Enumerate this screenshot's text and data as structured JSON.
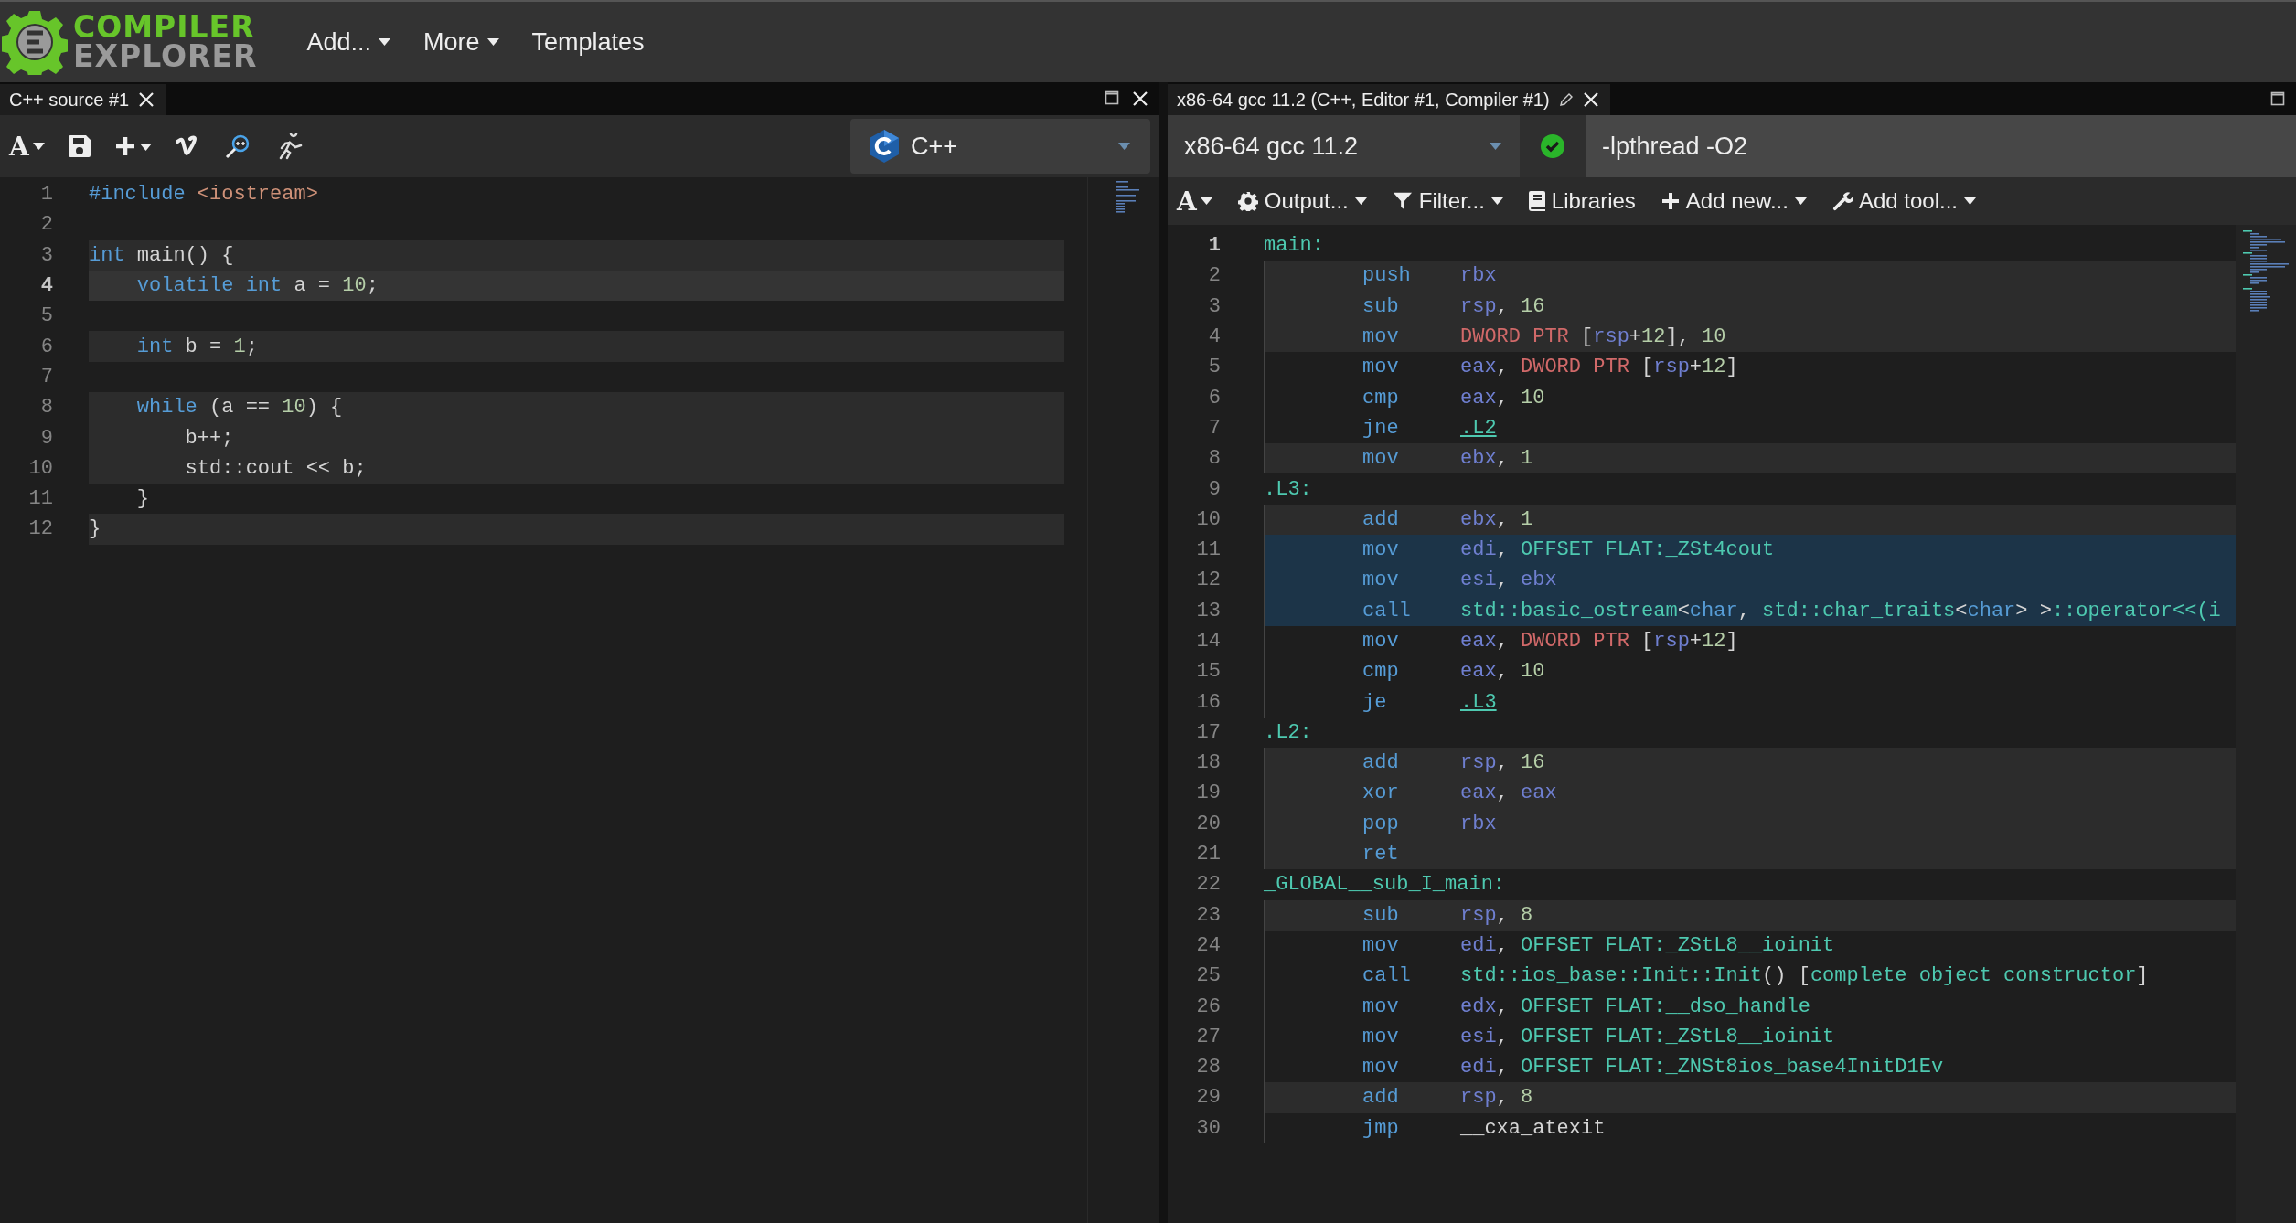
{
  "header": {
    "logo": {
      "line1": "COMPILER",
      "line2": "EXPLORER"
    },
    "menu": [
      {
        "label": "Add...",
        "dropdown": true
      },
      {
        "label": "More",
        "dropdown": true
      },
      {
        "label": "Templates",
        "dropdown": false
      }
    ]
  },
  "editor": {
    "tab": {
      "title": "C++ source #1"
    },
    "font_button": "A",
    "language": "C++",
    "lines": [
      {
        "number": "1",
        "current": false,
        "highlighted": false,
        "tokens": [
          {
            "kind": "keyword",
            "text": "#include"
          },
          {
            "kind": "string",
            "text": " <iostream>"
          }
        ]
      },
      {
        "number": "2",
        "current": false,
        "highlighted": false
      },
      {
        "number": "3",
        "current": false,
        "highlighted": true,
        "tokens": [
          {
            "kind": "keyword",
            "text": "int"
          },
          {
            "kind": "plain",
            "text": " main() {"
          }
        ]
      },
      {
        "number": "4",
        "current": true,
        "highlighted": true,
        "tokens": [
          {
            "kind": "keyword",
            "text": "    volatile"
          },
          {
            "kind": "keyword",
            "text": " int"
          },
          {
            "kind": "plain",
            "text": " a = "
          },
          {
            "kind": "number",
            "text": "10"
          },
          {
            "kind": "plain",
            "text": ";"
          }
        ]
      },
      {
        "number": "5",
        "current": false,
        "highlighted": false
      },
      {
        "number": "6",
        "current": false,
        "highlighted": true,
        "tokens": [
          {
            "kind": "keyword",
            "text": "    int"
          },
          {
            "kind": "plain",
            "text": " b = "
          },
          {
            "kind": "number",
            "text": "1"
          },
          {
            "kind": "plain",
            "text": ";"
          }
        ]
      },
      {
        "number": "7",
        "current": false,
        "highlighted": false
      },
      {
        "number": "8",
        "current": false,
        "highlighted": true,
        "tokens": [
          {
            "kind": "keyword",
            "text": "    while"
          },
          {
            "kind": "plain",
            "text": " (a == "
          },
          {
            "kind": "number",
            "text": "10"
          },
          {
            "kind": "plain",
            "text": ") {"
          }
        ]
      },
      {
        "number": "9",
        "current": false,
        "highlighted": true,
        "tokens": [
          {
            "kind": "plain",
            "text": "        b++;"
          }
        ]
      },
      {
        "number": "10",
        "current": false,
        "highlighted": true,
        "tokens": [
          {
            "kind": "plain",
            "text": "        std::cout << b;"
          }
        ]
      },
      {
        "number": "11",
        "current": false,
        "highlighted": false,
        "tokens": [
          {
            "kind": "plain",
            "text": "    }"
          }
        ]
      },
      {
        "number": "12",
        "current": false,
        "highlighted": true,
        "tokens": [
          {
            "kind": "plain",
            "text": "}"
          }
        ]
      }
    ]
  },
  "compiler": {
    "tab": {
      "title": "x86-64 gcc 11.2 (C++, Editor #1, Compiler #1)"
    },
    "name": "x86-64 gcc 11.2",
    "success": true,
    "options": "-lpthread -O2",
    "font_button": "A",
    "toolbar": [
      {
        "label": "Output...",
        "dropdown": true
      },
      {
        "label": "Filter...",
        "dropdown": true
      },
      {
        "label": "Libraries",
        "dropdown": false
      },
      {
        "label": "Add new...",
        "dropdown": true
      },
      {
        "label": "Add tool...",
        "dropdown": true
      }
    ],
    "lines": [
      {
        "number": "1",
        "current": true,
        "highlighted": false,
        "selected": false,
        "kind": "label",
        "tokens": [
          {
            "kind": "label",
            "text": "main:"
          }
        ]
      },
      {
        "number": "2",
        "current": false,
        "highlighted": true,
        "selected": false,
        "kind": "instruction",
        "mnemonic": "push",
        "tokens": [
          {
            "kind": "register",
            "text": "rbx"
          }
        ]
      },
      {
        "number": "3",
        "current": false,
        "highlighted": true,
        "selected": false,
        "kind": "instruction",
        "mnemonic": "sub",
        "tokens": [
          {
            "kind": "register",
            "text": "rsp"
          },
          {
            "kind": "plain",
            "text": ", "
          },
          {
            "kind": "number",
            "text": "16"
          }
        ]
      },
      {
        "number": "4",
        "current": false,
        "highlighted": true,
        "selected": false,
        "kind": "instruction",
        "mnemonic": "mov",
        "tokens": [
          {
            "kind": "size",
            "text": "DWORD PTR"
          },
          {
            "kind": "plain",
            "text": " ["
          },
          {
            "kind": "register",
            "text": "rsp"
          },
          {
            "kind": "plain",
            "text": "+"
          },
          {
            "kind": "number",
            "text": "12"
          },
          {
            "kind": "plain",
            "text": "], "
          },
          {
            "kind": "number",
            "text": "10"
          }
        ]
      },
      {
        "number": "5",
        "current": false,
        "highlighted": false,
        "selected": false,
        "kind": "instruction",
        "mnemonic": "mov",
        "tokens": [
          {
            "kind": "register",
            "text": "eax"
          },
          {
            "kind": "plain",
            "text": ", "
          },
          {
            "kind": "size",
            "text": "DWORD PTR"
          },
          {
            "kind": "plain",
            "text": " ["
          },
          {
            "kind": "register",
            "text": "rsp"
          },
          {
            "kind": "plain",
            "text": "+"
          },
          {
            "kind": "number",
            "text": "12"
          },
          {
            "kind": "plain",
            "text": "]"
          }
        ]
      },
      {
        "number": "6",
        "current": false,
        "highlighted": false,
        "selected": false,
        "kind": "instruction",
        "mnemonic": "cmp",
        "tokens": [
          {
            "kind": "register",
            "text": "eax"
          },
          {
            "kind": "plain",
            "text": ", "
          },
          {
            "kind": "number",
            "text": "10"
          }
        ]
      },
      {
        "number": "7",
        "current": false,
        "highlighted": false,
        "selected": false,
        "kind": "instruction",
        "mnemonic": "jne",
        "tokens": [
          {
            "kind": "link",
            "text": ".L2"
          }
        ]
      },
      {
        "number": "8",
        "current": false,
        "highlighted": true,
        "selected": false,
        "kind": "instruction",
        "mnemonic": "mov",
        "tokens": [
          {
            "kind": "register",
            "text": "ebx"
          },
          {
            "kind": "plain",
            "text": ", "
          },
          {
            "kind": "number",
            "text": "1"
          }
        ]
      },
      {
        "number": "9",
        "current": false,
        "highlighted": false,
        "selected": false,
        "kind": "label",
        "tokens": [
          {
            "kind": "label",
            "text": ".L3:"
          }
        ]
      },
      {
        "number": "10",
        "current": false,
        "highlighted": true,
        "selected": false,
        "kind": "instruction",
        "mnemonic": "add",
        "tokens": [
          {
            "kind": "register",
            "text": "ebx"
          },
          {
            "kind": "plain",
            "text": ", "
          },
          {
            "kind": "number",
            "text": "1"
          }
        ]
      },
      {
        "number": "11",
        "current": false,
        "selected": true,
        "kind": "instruction",
        "mnemonic": "mov",
        "tokens": [
          {
            "kind": "register",
            "text": "edi"
          },
          {
            "kind": "plain",
            "text": ", "
          },
          {
            "kind": "symbol",
            "text": "OFFSET FLAT:_ZSt4cout"
          }
        ]
      },
      {
        "number": "12",
        "current": false,
        "selected": true,
        "kind": "instruction",
        "mnemonic": "mov",
        "tokens": [
          {
            "kind": "register",
            "text": "esi"
          },
          {
            "kind": "plain",
            "text": ", "
          },
          {
            "kind": "register",
            "text": "ebx"
          }
        ]
      },
      {
        "number": "13",
        "current": false,
        "selected": true,
        "kind": "instruction",
        "mnemonic": "call",
        "tokens": [
          {
            "kind": "symbol",
            "text": "std::basic_ostream"
          },
          {
            "kind": "plain",
            "text": "<"
          },
          {
            "kind": "keyword",
            "text": "char"
          },
          {
            "kind": "plain",
            "text": ", "
          },
          {
            "kind": "symbol",
            "text": "std::char_traits"
          },
          {
            "kind": "plain",
            "text": "<"
          },
          {
            "kind": "keyword",
            "text": "char"
          },
          {
            "kind": "plain",
            "text": "> >"
          },
          {
            "kind": "symbol",
            "text": "::operator<<(i"
          }
        ]
      },
      {
        "number": "14",
        "current": false,
        "highlighted": false,
        "selected": false,
        "kind": "instruction",
        "mnemonic": "mov",
        "tokens": [
          {
            "kind": "register",
            "text": "eax"
          },
          {
            "kind": "plain",
            "text": ", "
          },
          {
            "kind": "size",
            "text": "DWORD PTR"
          },
          {
            "kind": "plain",
            "text": " ["
          },
          {
            "kind": "register",
            "text": "rsp"
          },
          {
            "kind": "plain",
            "text": "+"
          },
          {
            "kind": "number",
            "text": "12"
          },
          {
            "kind": "plain",
            "text": "]"
          }
        ]
      },
      {
        "number": "15",
        "current": false,
        "highlighted": false,
        "selected": false,
        "kind": "instruction",
        "mnemonic": "cmp",
        "tokens": [
          {
            "kind": "register",
            "text": "eax"
          },
          {
            "kind": "plain",
            "text": ", "
          },
          {
            "kind": "number",
            "text": "10"
          }
        ]
      },
      {
        "number": "16",
        "current": false,
        "highlighted": false,
        "selected": false,
        "kind": "instruction",
        "mnemonic": "je",
        "tokens": [
          {
            "kind": "link",
            "text": ".L3"
          }
        ]
      },
      {
        "number": "17",
        "current": false,
        "highlighted": false,
        "selected": false,
        "kind": "label",
        "tokens": [
          {
            "kind": "label",
            "text": ".L2:"
          }
        ]
      },
      {
        "number": "18",
        "current": false,
        "highlighted": true,
        "selected": false,
        "kind": "instruction",
        "mnemonic": "add",
        "tokens": [
          {
            "kind": "register",
            "text": "rsp"
          },
          {
            "kind": "plain",
            "text": ", "
          },
          {
            "kind": "number",
            "text": "16"
          }
        ]
      },
      {
        "number": "19",
        "current": false,
        "highlighted": true,
        "selected": false,
        "kind": "instruction",
        "mnemonic": "xor",
        "tokens": [
          {
            "kind": "register",
            "text": "eax"
          },
          {
            "kind": "plain",
            "text": ", "
          },
          {
            "kind": "register",
            "text": "eax"
          }
        ]
      },
      {
        "number": "20",
        "current": false,
        "highlighted": true,
        "selected": false,
        "kind": "instruction",
        "mnemonic": "pop",
        "tokens": [
          {
            "kind": "register",
            "text": "rbx"
          }
        ]
      },
      {
        "number": "21",
        "current": false,
        "highlighted": true,
        "selected": false,
        "kind": "instruction",
        "mnemonic": "ret"
      },
      {
        "number": "22",
        "current": false,
        "highlighted": false,
        "selected": false,
        "kind": "label",
        "tokens": [
          {
            "kind": "label",
            "text": "_GLOBAL__sub_I_main:"
          }
        ]
      },
      {
        "number": "23",
        "current": false,
        "highlighted": true,
        "selected": false,
        "kind": "instruction",
        "mnemonic": "sub",
        "tokens": [
          {
            "kind": "register",
            "text": "rsp"
          },
          {
            "kind": "plain",
            "text": ", "
          },
          {
            "kind": "number",
            "text": "8"
          }
        ]
      },
      {
        "number": "24",
        "current": false,
        "highlighted": false,
        "selected": false,
        "kind": "instruction",
        "mnemonic": "mov",
        "tokens": [
          {
            "kind": "register",
            "text": "edi"
          },
          {
            "kind": "plain",
            "text": ", "
          },
          {
            "kind": "symbol",
            "text": "OFFSET FLAT:_ZStL8__ioinit"
          }
        ]
      },
      {
        "number": "25",
        "current": false,
        "highlighted": false,
        "selected": false,
        "kind": "instruction",
        "mnemonic": "call",
        "tokens": [
          {
            "kind": "symbol",
            "text": "std::ios_base::Init::Init"
          },
          {
            "kind": "plain",
            "text": "() ["
          },
          {
            "kind": "symbol",
            "text": "complete object constructor"
          },
          {
            "kind": "plain",
            "text": "]"
          }
        ]
      },
      {
        "number": "26",
        "current": false,
        "highlighted": false,
        "selected": false,
        "kind": "instruction",
        "mnemonic": "mov",
        "tokens": [
          {
            "kind": "register",
            "text": "edx"
          },
          {
            "kind": "plain",
            "text": ", "
          },
          {
            "kind": "symbol",
            "text": "OFFSET FLAT:__dso_handle"
          }
        ]
      },
      {
        "number": "27",
        "current": false,
        "highlighted": false,
        "selected": false,
        "kind": "instruction",
        "mnemonic": "mov",
        "tokens": [
          {
            "kind": "register",
            "text": "esi"
          },
          {
            "kind": "plain",
            "text": ", "
          },
          {
            "kind": "symbol",
            "text": "OFFSET FLAT:_ZStL8__ioinit"
          }
        ]
      },
      {
        "number": "28",
        "current": false,
        "highlighted": false,
        "selected": false,
        "kind": "instruction",
        "mnemonic": "mov",
        "tokens": [
          {
            "kind": "register",
            "text": "edi"
          },
          {
            "kind": "plain",
            "text": ", "
          },
          {
            "kind": "symbol",
            "text": "OFFSET FLAT:_ZNSt8ios_base4InitD1Ev"
          }
        ]
      },
      {
        "number": "29",
        "current": false,
        "highlighted": true,
        "selected": false,
        "kind": "instruction",
        "mnemonic": "add",
        "tokens": [
          {
            "kind": "register",
            "text": "rsp"
          },
          {
            "kind": "plain",
            "text": ", "
          },
          {
            "kind": "number",
            "text": "8"
          }
        ]
      },
      {
        "number": "30",
        "current": false,
        "highlighted": false,
        "selected": false,
        "kind": "instruction",
        "mnemonic": "jmp",
        "tokens": [
          {
            "kind": "plain",
            "text": "__cxa_atexit"
          }
        ]
      }
    ]
  }
}
